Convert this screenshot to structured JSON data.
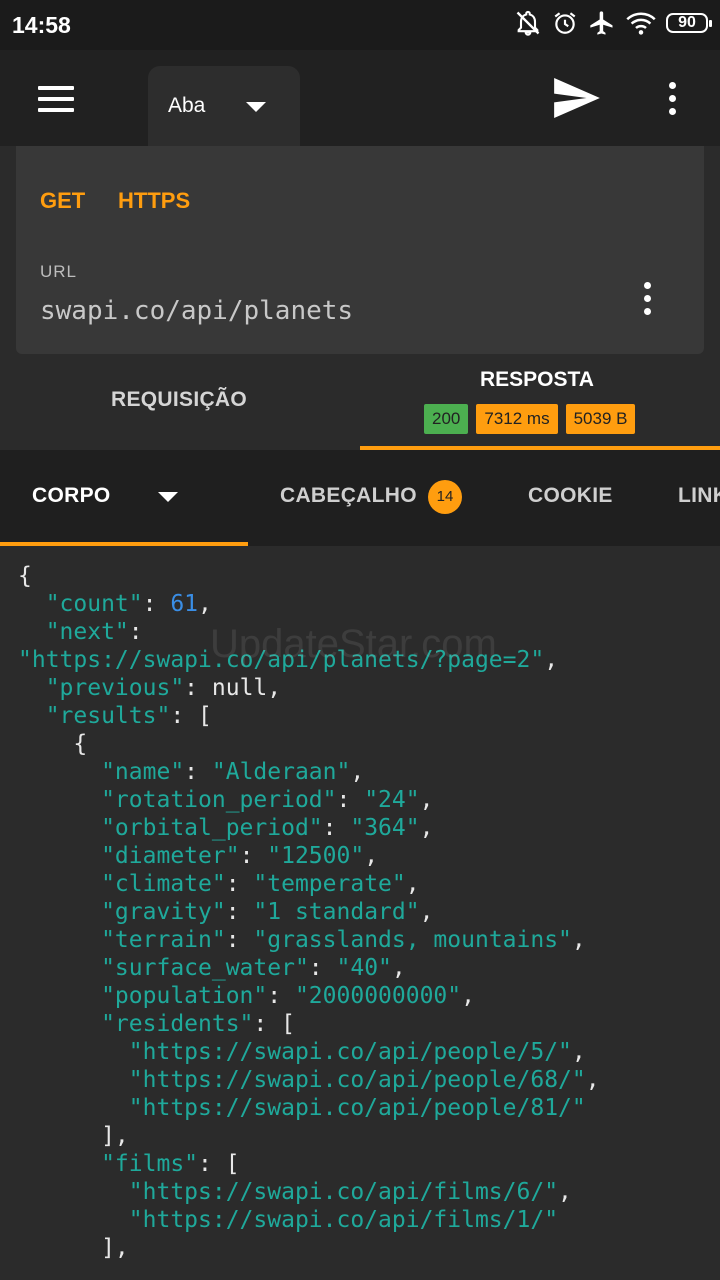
{
  "status_bar": {
    "time": "14:58",
    "battery": "90"
  },
  "app_bar": {
    "tab_label": "Aba"
  },
  "request": {
    "method": "GET",
    "protocol": "HTTPS",
    "url_label": "URL",
    "url_value": "swapi.co/api/planets"
  },
  "main_tabs": {
    "request_label": "REQUISIÇÃO",
    "response_label": "RESPOSTA",
    "status_code": "200",
    "time": "7312 ms",
    "size": "5039 B"
  },
  "sub_tabs": {
    "body": "CORPO",
    "headers": "CABEÇALHO",
    "headers_count": "14",
    "cookie": "COOKIE",
    "link": "LINK"
  },
  "watermark": "UpdateStar.com",
  "colors": {
    "accent": "#ff9d0f",
    "success": "#4caf50",
    "json_key": "#1fa99b",
    "json_number": "#3a8ee6"
  },
  "json_lines": [
    {
      "t": "{"
    },
    {
      "k": "  \"count\"",
      "p": ": ",
      "n": "61",
      "e": ","
    },
    {
      "k": "  \"next\"",
      "p": ":"
    },
    {
      "s": "\"https://swapi.co/api/planets/?page=2\"",
      "e": ","
    },
    {
      "k": "  \"previous\"",
      "p": ": ",
      "v": "null",
      "e": ","
    },
    {
      "k": "  \"results\"",
      "p": ": ["
    },
    {
      "t": "    {"
    },
    {
      "k": "      \"name\"",
      "p": ": ",
      "s": "\"Alderaan\"",
      "e": ","
    },
    {
      "k": "      \"rotation_period\"",
      "p": ": ",
      "s": "\"24\"",
      "e": ","
    },
    {
      "k": "      \"orbital_period\"",
      "p": ": ",
      "s": "\"364\"",
      "e": ","
    },
    {
      "k": "      \"diameter\"",
      "p": ": ",
      "s": "\"12500\"",
      "e": ","
    },
    {
      "k": "      \"climate\"",
      "p": ": ",
      "s": "\"temperate\"",
      "e": ","
    },
    {
      "k": "      \"gravity\"",
      "p": ": ",
      "s": "\"1 standard\"",
      "e": ","
    },
    {
      "k": "      \"terrain\"",
      "p": ": ",
      "s": "\"grasslands, mountains\"",
      "e": ","
    },
    {
      "k": "      \"surface_water\"",
      "p": ": ",
      "s": "\"40\"",
      "e": ","
    },
    {
      "k": "      \"population\"",
      "p": ": ",
      "s": "\"2000000000\"",
      "e": ","
    },
    {
      "k": "      \"residents\"",
      "p": ": ["
    },
    {
      "s": "        \"https://swapi.co/api/people/5/\"",
      "e": ","
    },
    {
      "s": "        \"https://swapi.co/api/people/68/\"",
      "e": ","
    },
    {
      "s": "        \"https://swapi.co/api/people/81/\""
    },
    {
      "t": "      ],"
    },
    {
      "k": "      \"films\"",
      "p": ": ["
    },
    {
      "s": "        \"https://swapi.co/api/films/6/\"",
      "e": ","
    },
    {
      "s": "        \"https://swapi.co/api/films/1/\""
    },
    {
      "t": "      ],"
    }
  ]
}
